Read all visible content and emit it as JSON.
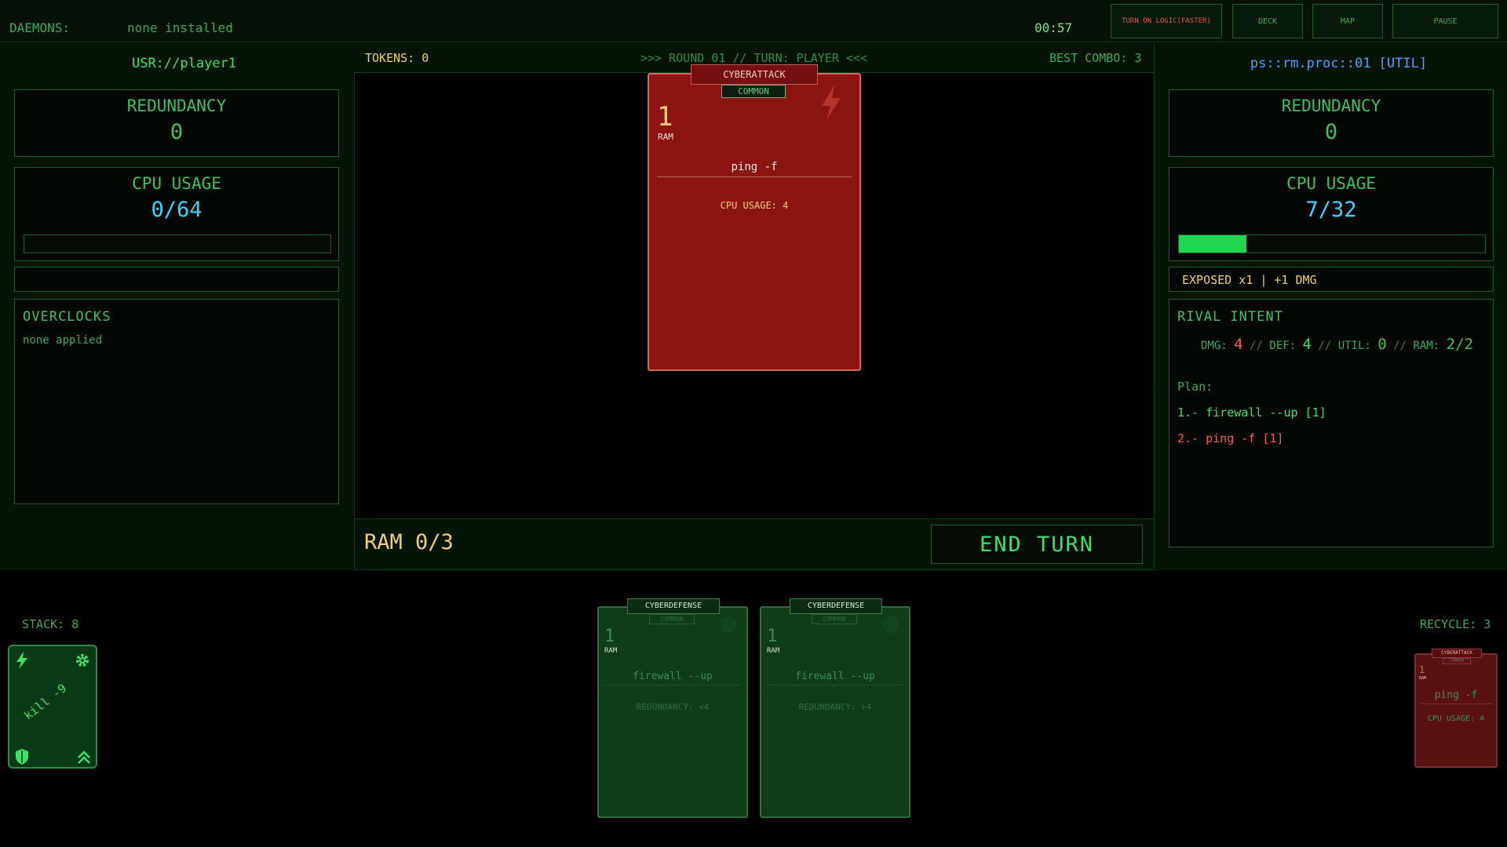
{
  "topbar": {
    "daemons_label": "DAEMONS:",
    "daemons_value": "none installed",
    "timer": "00:57",
    "buttons": {
      "logic": "TURN ON LOGIC(FASTER)",
      "deck": "DECK",
      "map": "MAP",
      "pause": "PAUSE"
    }
  },
  "player": {
    "name": "USR://player1",
    "redundancy_label": "REDUNDANCY",
    "redundancy_value": "0",
    "cpu_label": "CPU USAGE",
    "cpu_value": "0/64",
    "cpu_fraction": 0,
    "status_text": "",
    "overclocks_title": "OVERCLOCKS",
    "overclocks_value": "none applied"
  },
  "rival": {
    "name": "ps::rm.proc::01 [UTIL]",
    "redundancy_label": "REDUNDANCY",
    "redundancy_value": "0",
    "cpu_label": "CPU USAGE",
    "cpu_value": "7/32",
    "cpu_fraction": 0.22,
    "status_text": "EXPOSED x1 | +1 DMG",
    "intent_title": "RIVAL INTENT",
    "intent": {
      "dmg_label": "DMG:",
      "dmg_value": "4",
      "def_label": "DEF:",
      "def_value": "4",
      "util_label": "UTIL:",
      "util_value": "0",
      "ram_label": "RAM:",
      "ram_value": "2/2",
      "sep": "//"
    },
    "plan_label": "Plan:",
    "plan": [
      "1.- firewall --up [1]",
      "2.- ping -f [1]"
    ]
  },
  "round": {
    "tokens": "TOKENS: 0",
    "banner": ">>> ROUND 01 // TURN: PLAYER <<<",
    "best_combo": "BEST COMBO: 3"
  },
  "played_card": {
    "type": "CYBERATTACK",
    "rarity": "COMMON",
    "cost": "1",
    "cost_label": "RAM",
    "name": "ping -f",
    "effect": "CPU USAGE: 4"
  },
  "footer": {
    "ram": "RAM 0/3",
    "end_turn": "END TURN"
  },
  "stack": {
    "label": "STACK: 8",
    "card_text": "kill -9"
  },
  "hand": [
    {
      "type": "CYBERDEFENSE",
      "rarity": "COMMON",
      "cost": "1",
      "cost_label": "RAM",
      "name": "firewall --up",
      "effect": "REDUNDANCY: +4"
    },
    {
      "type": "CYBERDEFENSE",
      "rarity": "COMMON",
      "cost": "1",
      "cost_label": "RAM",
      "name": "firewall --up",
      "effect": "REDUNDANCY: +4"
    }
  ],
  "recycle": {
    "label": "RECYCLE: 3",
    "card": {
      "type": "CYBERATTACK",
      "rarity": "COMMON",
      "cost": "1",
      "cost_label": "RAM",
      "name": "ping -f",
      "effect": "CPU USAGE: 4"
    }
  },
  "colors": {
    "accent_green": "#3fe068",
    "cyan": "#3fd2ff",
    "yellow": "#f0d070",
    "red": "#ff5a4a",
    "attack_card": "#8c1512",
    "defense_card": "#0e3d18"
  }
}
